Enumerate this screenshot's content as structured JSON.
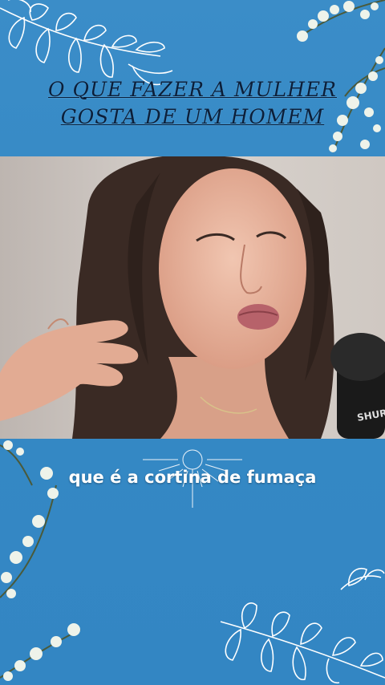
{
  "title": {
    "line1": "O QUE FAZER A MULHER",
    "line2": "GOSTA DE UM HOMEM"
  },
  "video": {
    "microphone_brand": "SHURE"
  },
  "caption": {
    "text": "que é a cortina de fumaça"
  },
  "colors": {
    "background": "#3a8ac4",
    "title_text": "#0b1f3a",
    "caption_text": "#ffffff",
    "leaf_outline": "#ffffff"
  }
}
